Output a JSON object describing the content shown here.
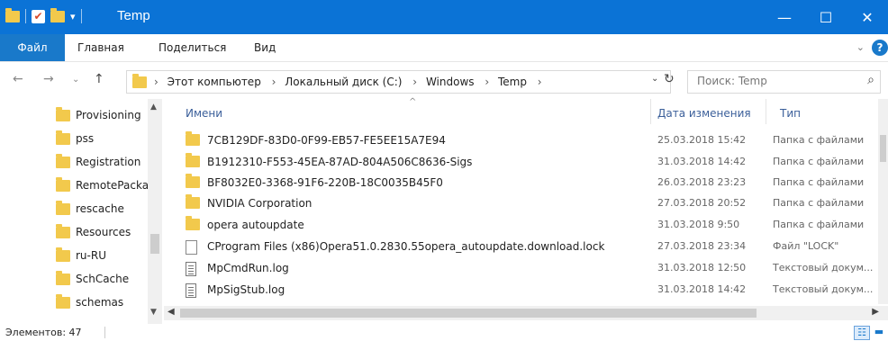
{
  "window": {
    "title": "Temp",
    "buttons": {
      "minimize": "—",
      "maximize": "☐",
      "close": "✕"
    }
  },
  "ribbon": {
    "tabs": [
      "Файл",
      "Главная",
      "Поделиться",
      "Вид"
    ]
  },
  "address": {
    "crumbs": [
      "Этот компьютер",
      "Локальный диск (C:)",
      "Windows",
      "Temp"
    ],
    "search_placeholder": "Поиск: Temp"
  },
  "nav_pane": {
    "items": [
      "Provisioning",
      "pss",
      "Registration",
      "RemotePackages",
      "rescache",
      "Resources",
      "ru-RU",
      "SchCache",
      "schemas"
    ]
  },
  "columns": {
    "name": "Имени",
    "date": "Дата изменения",
    "type": "Тип"
  },
  "files": [
    {
      "name": "7CB129DF-83D0-0F99-EB57-FE5EE15A7E94",
      "date": "25.03.2018 15:42",
      "type": "Папка с файлами",
      "icon": "folder-icon"
    },
    {
      "name": "B1912310-F553-45EA-87AD-804A506C8636-Sigs",
      "date": "31.03.2018 14:42",
      "type": "Папка с файлами",
      "icon": "folder-icon"
    },
    {
      "name": "BF8032E0-3368-91F6-220B-18C0035B45F0",
      "date": "26.03.2018 23:23",
      "type": "Папка с файлами",
      "icon": "folder-icon"
    },
    {
      "name": "NVIDIA Corporation",
      "date": "27.03.2018 20:52",
      "type": "Папка с файлами",
      "icon": "folder-icon"
    },
    {
      "name": "opera autoupdate",
      "date": "31.03.2018 9:50",
      "type": "Папка с файлами",
      "icon": "folder-icon"
    },
    {
      "name": "CProgram Files (x86)Opera51.0.2830.55opera_autoupdate.download.lock",
      "date": "27.03.2018 23:34",
      "type": "Файл \"LOCK\"",
      "icon": "file-icon"
    },
    {
      "name": "MpCmdRun.log",
      "date": "31.03.2018 12:50",
      "type": "Текстовый докум...",
      "icon": "text-file-icon"
    },
    {
      "name": "MpSigStub.log",
      "date": "31.03.2018 14:42",
      "type": "Текстовый докум...",
      "icon": "text-file-icon"
    }
  ],
  "status": {
    "count": "Элементов: 47"
  }
}
